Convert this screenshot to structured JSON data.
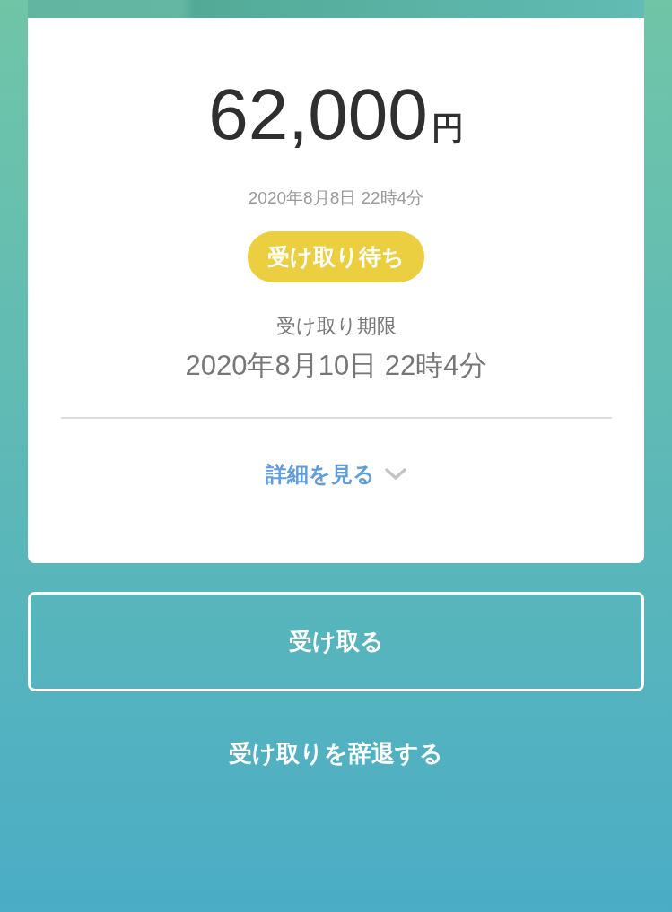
{
  "amount": {
    "value": "62,000",
    "unit": "円"
  },
  "sent_at": "2020年8月8日 22時4分",
  "status_badge": "受け取り待ち",
  "deadline": {
    "label": "受け取り期限",
    "value": "2020年8月10日 22時4分"
  },
  "details_link": "詳細を見る",
  "receive_button": "受け取る",
  "decline_link": "受け取りを辞退する"
}
